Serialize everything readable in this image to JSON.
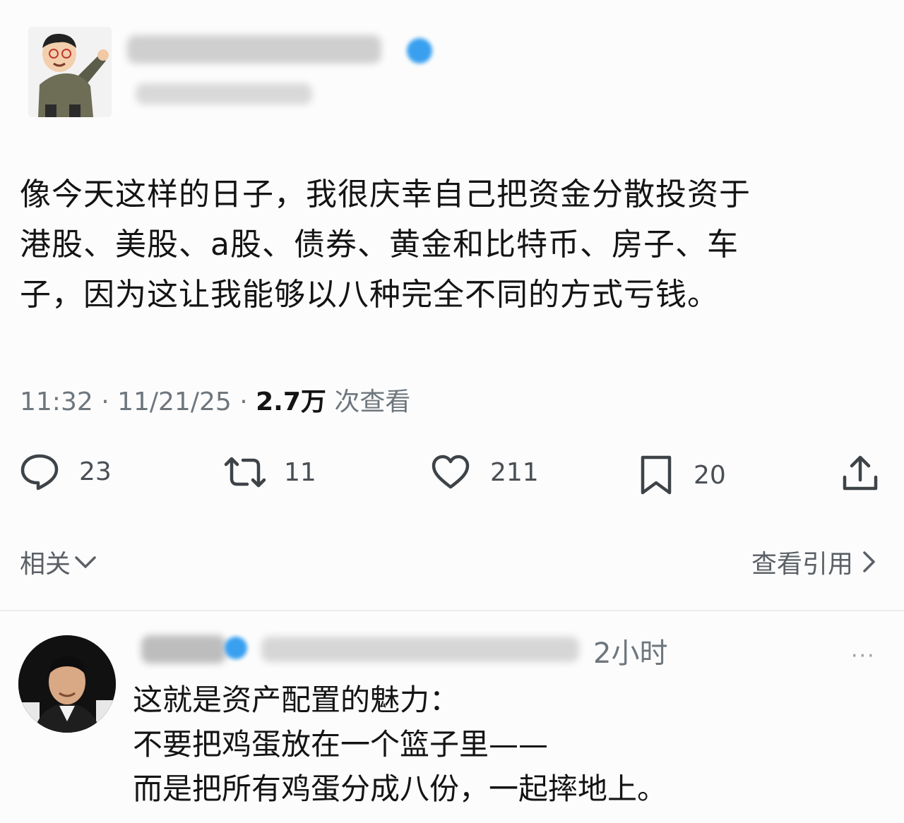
{
  "tweet": {
    "text": "像今天这样的日子，我很庆幸自己把资金分散投资于\n港股、美股、a股、债券、黄金和比特币、房子、车\n子，因为这让我能够以八种完全不同的方式亏钱。",
    "time": "11:32 · 11/21/25 · ",
    "views_count": "2.7万",
    "views_label": " 次查看"
  },
  "actions": {
    "replies": "23",
    "retweets": "11",
    "likes": "211",
    "bookmarks": "20"
  },
  "nav": {
    "related": "相关",
    "view_quotes": "查看引用"
  },
  "reply": {
    "time": "2小时",
    "more": "···",
    "text": "这就是资产配置的魅力：\n不要把鸡蛋放在一个篮子里——\n而是把所有鸡蛋分成八份，一起摔地上。"
  },
  "colors": {
    "verified": "#39a0ef",
    "muted": "#6e767d"
  }
}
